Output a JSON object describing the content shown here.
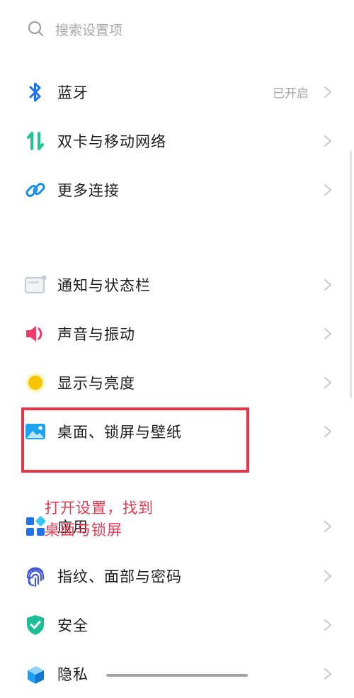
{
  "search": {
    "icon": "search-icon",
    "placeholder": "搜索设置项"
  },
  "settings": [
    {
      "icon": "bluetooth-icon",
      "label": "蓝牙",
      "status": "已开启"
    },
    {
      "icon": "dual-sim-icon",
      "label": "双卡与移动网络"
    },
    {
      "icon": "link-icon",
      "label": "更多连接"
    },
    {
      "icon": "notification-bar-icon",
      "label": "通知与状态栏"
    },
    {
      "icon": "speaker-icon",
      "label": "声音与振动"
    },
    {
      "icon": "sun-icon",
      "label": "显示与亮度"
    },
    {
      "icon": "wallpaper-icon",
      "label": "桌面、锁屏与壁纸"
    },
    {
      "icon": "apps-grid-icon",
      "label": "应用"
    },
    {
      "icon": "fingerprint-icon",
      "label": "指纹、面部与密码"
    },
    {
      "icon": "shield-check-icon",
      "label": "安全"
    },
    {
      "icon": "privacy-icon",
      "label": "隐私"
    }
  ],
  "annotation": {
    "line1": "打开设置，找到",
    "line2": "桌面与锁屏"
  },
  "colors": {
    "bluetooth": "#1e6ff0",
    "dual_sim": "#1fc48c",
    "link": "#1a8ef0",
    "notification": "#c7ccd3",
    "speaker": "#ef3a6b",
    "sun": "#f9c400",
    "wallpaper": "#19a3f0",
    "apps": "#1e72ee",
    "fingerprint": "#4055d8",
    "shield": "#1bbf93",
    "privacy": "#1c9ff2",
    "highlight": "#e8334a"
  }
}
